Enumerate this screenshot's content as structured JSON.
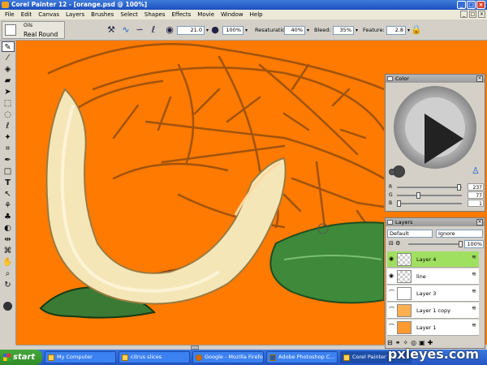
{
  "window": {
    "title": "Corel Painter 12 - [orange.psd @ 100%]"
  },
  "menu": [
    "File",
    "Edit",
    "Canvas",
    "Layers",
    "Brushes",
    "Select",
    "Shapes",
    "Effects",
    "Movie",
    "Window",
    "Help"
  ],
  "brush": {
    "category": "Oils",
    "variant": "Real Round"
  },
  "props": {
    "size_value": "21.0",
    "opacity_value": "100%",
    "resaturation_label": "Resaturation:",
    "resaturation_value": "40%",
    "bleed_label": "Bleed:",
    "bleed_value": "35%",
    "feature_label": "Feature:",
    "feature_value": "2.8"
  },
  "color_panel": {
    "title": "Color",
    "r_label": "R",
    "r_value": "237",
    "g_label": "G",
    "g_value": "77",
    "b_label": "B",
    "b_value": "1",
    "main_color": "#ed4d01"
  },
  "layers_panel": {
    "title": "Layers",
    "composite_method": "Default",
    "depth_method": "Ignore",
    "opacity": "100%",
    "layers": [
      {
        "name": "Layer 4",
        "selected": true
      },
      {
        "name": "line",
        "selected": false
      },
      {
        "name": "Layer 3",
        "selected": false
      },
      {
        "name": "Layer 1 copy",
        "selected": false
      },
      {
        "name": "Layer 1",
        "selected": false
      }
    ]
  },
  "taskbar": {
    "start": "start",
    "tasks": [
      "My Computer",
      "citrus slices",
      "Google - Mozilla Firefox",
      "Adobe Photoshop C...",
      "Corel Painter 12..."
    ]
  },
  "watermark": "pxleyes.com",
  "colors": {
    "canvas_bg": "#ff7a00",
    "accent": "#a0e060"
  }
}
